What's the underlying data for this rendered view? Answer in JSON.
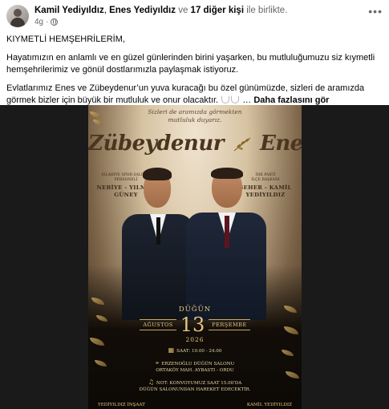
{
  "post": {
    "author_a": "Kamil Yediyıldız",
    "separator": ", ",
    "author_b": "Enes Yediyıldız",
    "with_text": " ve ",
    "others": "17 diğer kişi",
    "together": " ile birlikte.",
    "time": "4g",
    "time_sep": "·",
    "para1": "KIYMETLİ HEMŞEHRİLERİM,",
    "para2": "Hayatımızın en anlamlı ve en güzel günlerinden birini yaşarken, bu mutluluğumuzu siz kıymetli hemşehrilerimiz ve gönül dostlarımızla paylaşmak istiyoruz.",
    "para3": "Evlatlarımız Enes ve Zübeydenur’un yuva kuracağı bu özel günümüzde, sizleri de aramızda görmek bizler için büyük bir mutluluk ve onur olacaktır.",
    "ellipsis": " …",
    "see_more": "Daha fazlasını gör"
  },
  "invite": {
    "top_line1": "Sizleri de aramızda görmekten",
    "top_line2": "mutluluk duyarız.",
    "bride": "Zübeydenur",
    "groom": "Enes",
    "left_small1": "ISLAHIYE SPOR SALONU",
    "left_small2": "PERSONELİ",
    "left_big1": "NEBİYE - YILMAZ",
    "left_big2": "GÜNEY",
    "right_small1": "İHK PARTİ",
    "right_small2": "İLÇE BAŞKANI",
    "right_big1": "SEHER - KAMİL",
    "right_big2": "YEDİYILDIZ",
    "dugun": "DÜĞÜN",
    "month": "AĞUSTOS",
    "day": "13",
    "weekday": "PERŞEMBE",
    "year": "2026",
    "time": "SAAT: 10.00 - 24.00",
    "venue1": "ERZENOĞLU DÜĞÜN SALONU",
    "venue2": "ORTAKÖY MAH. AYBASTI - ORDU",
    "note1": "NOT: KONVOYUMUZ SAAT 15.00'DA",
    "note2": "DÜĞÜN SALONUNDAN HAREKET EDECEKTİR.",
    "footer_left": "YEDİYILDIZ İNŞAAT",
    "footer_right": "KAMİL YEDİYILDIZ"
  },
  "colors": {
    "text": "#050505",
    "muted": "#65676b",
    "gold": "#e6c77f"
  },
  "icons": {
    "more": "more-horizontal-icon",
    "privacy": "globe-icon"
  }
}
